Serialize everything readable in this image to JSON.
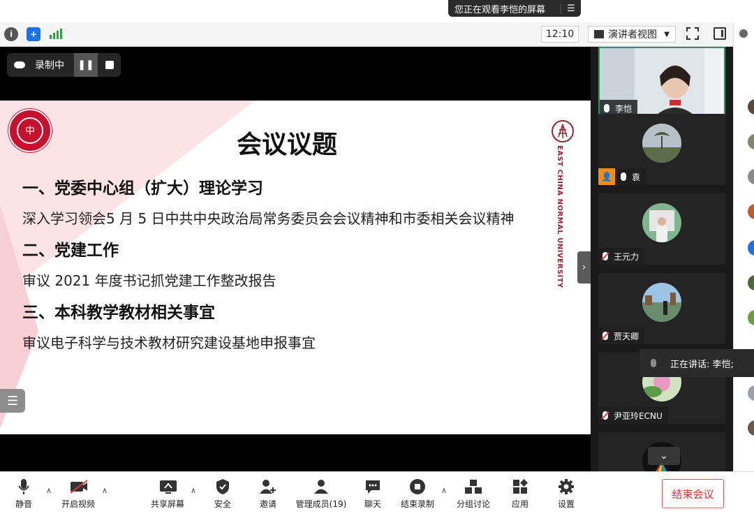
{
  "share_banner": {
    "text": "您正在观看李恺的屏幕",
    "menu_icon": "menu-icon"
  },
  "toolbar": {
    "icons": [
      "info-icon",
      "shield-icon",
      "signal-icon"
    ],
    "time": "12:10",
    "view_mode": "演讲者视图",
    "icons_right": [
      "fullscreen-icon",
      "side-panel-icon"
    ]
  },
  "recording": {
    "label": "录制中"
  },
  "slide": {
    "title": "会议议题",
    "sections": [
      {
        "heading": "一、党委中心组（扩大）理论学习",
        "body": "深入学习领会5 月 5 日中共中央政治局常务委员会会议精神和市委相关会议精神"
      },
      {
        "heading": "二、党建工作",
        "body": "审议 2021 年度书记抓党建工作整改报告"
      },
      {
        "heading": "三、本科教学教材相关事宜",
        "body": "审议电子科学与技术教材研究建设基地申报事宜"
      }
    ],
    "university_text": "EAST CHINA NORMAL UNIVERSITY"
  },
  "participants": [
    {
      "name": "李恺",
      "muted": false,
      "active": true
    },
    {
      "name": "袁",
      "muted": false,
      "host": true
    },
    {
      "name": "王元力",
      "muted": true
    },
    {
      "name": "贾天卿",
      "muted": true
    },
    {
      "name": "尹亚玲ECNU",
      "muted": true
    },
    {
      "name": "",
      "muted": true
    }
  ],
  "speaking": {
    "text": "正在讲话: 李恺;"
  },
  "bottom_bar": {
    "items": [
      {
        "label": "静音",
        "icon": "microphone-icon"
      },
      {
        "label": "开启视频",
        "icon": "video-off-icon"
      },
      {
        "label": "共享屏幕",
        "icon": "share-screen-icon"
      },
      {
        "label": "安全",
        "icon": "security-shield-icon"
      },
      {
        "label": "邀请",
        "icon": "invite-user-icon"
      },
      {
        "label": "管理成员(19)",
        "icon": "participants-icon"
      },
      {
        "label": "聊天",
        "icon": "chat-icon"
      },
      {
        "label": "结束录制",
        "icon": "stop-record-icon"
      },
      {
        "label": "分组讨论",
        "icon": "breakout-icon"
      },
      {
        "label": "应用",
        "icon": "apps-icon"
      },
      {
        "label": "设置",
        "icon": "settings-gear-icon"
      }
    ],
    "end_meeting": "结束会议"
  },
  "colors": {
    "active_border": "#1f9e5a",
    "end_meeting": "#e03131",
    "ecnu_red": "#a22030"
  }
}
